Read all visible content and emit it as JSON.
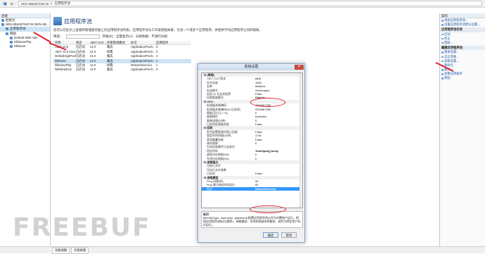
{
  "address": {
    "host": "WIN-3B54E7N87J9",
    "page": "应用程序池"
  },
  "left": {
    "header": "连接",
    "tree": [
      {
        "label": "起始页",
        "depth": 0
      },
      {
        "label": "WIN-3B54E7N87J9 (WIN-3B...",
        "depth": 0
      },
      {
        "label": "应用程序池",
        "depth": 1,
        "selected": true
      },
      {
        "label": "网站",
        "depth": 1
      },
      {
        "label": "Default Web Site",
        "depth": 2
      },
      {
        "label": "hillstonePhp",
        "depth": 2
      },
      {
        "label": "hillstone",
        "depth": 2
      }
    ]
  },
  "main": {
    "title": "应用程序池",
    "description": "您可以在此页上查看和管理服务器上的应用程序池列表。应用程序池与工作进程相关联，包含一个或多个应用程序，并提供不同应用程序之间的隔离。",
    "filter": {
      "label": "筛选：",
      "go": "开始(G)",
      "show_all": "全部显示(A)",
      "group_by": "分组依据：不进行分组"
    },
    "columns": [
      "名称",
      "状态",
      ".NET CLR...",
      "托管管道模式",
      "标识",
      "应用程序"
    ],
    "rows": [
      [
        ".NET v4.5",
        "已启动",
        "v4.0",
        "集成",
        "ApplicationPoolI...",
        "0"
      ],
      [
        ".NET v4.5 Clas...",
        "已启动",
        "v4.0",
        "经典",
        "ApplicationPoolI...",
        "0"
      ],
      [
        "DefaultAppPool",
        "已启动",
        "v4.0",
        "集成",
        "ApplicationPoolI...",
        "4"
      ],
      [
        "hillstone",
        "已启动",
        "v4.0",
        "集成",
        "ApplicationPoolI...",
        "1"
      ],
      [
        "hillstonePhp",
        "已启动",
        "v4.0",
        "经典",
        "NetworkService",
        "1"
      ],
      [
        "NDWebdocs",
        "已启动",
        "v4.0",
        "集成",
        "ApplicationPoolI...",
        "0"
      ]
    ],
    "selected_row": 3
  },
  "dialog": {
    "title": "高级设置",
    "props": [
      {
        "cat": true,
        "name": "(常规)"
      },
      {
        "name": ".NET CLR 版本",
        "value": "v4.0",
        "bold": true
      },
      {
        "name": "队列长度",
        "value": "1000"
      },
      {
        "name": "名称",
        "value": "hillstone"
      },
      {
        "name": "启动模式",
        "value": "OnDemand"
      },
      {
        "name": "启用 32 位应用程序",
        "value": "False"
      },
      {
        "name": "托管管道模式",
        "value": "Classic",
        "bold": true
      },
      {
        "cat": true,
        "name": "CPU"
      },
      {
        "name": "处理器关联掩码",
        "value": "4294967295"
      },
      {
        "name": "处理器关联掩码(64 位选项)",
        "value": "4294967295"
      },
      {
        "name": "限制(百分之一%)",
        "value": "0"
      },
      {
        "name": "限制操作",
        "value": "NoAction"
      },
      {
        "name": "限制间隔(分钟)",
        "value": "5"
      },
      {
        "name": "已启用处理器关联",
        "value": "False"
      },
      {
        "cat": true,
        "name": "回收"
      },
      {
        "name": "发生配置更改时禁止回收",
        "value": "False"
      },
      {
        "name": "固定时间间隔(分钟)",
        "value": "1740"
      },
      {
        "name": "禁用重叠回收",
        "value": "False"
      },
      {
        "name": "请求限制",
        "value": "0"
      },
      {
        "name": "生成回收事件日志条目",
        "value": ""
      },
      {
        "name": "特定时间",
        "value": "TimeSpan[] Array",
        "bold": true
      },
      {
        "name": "虚拟内存限制(KB)",
        "value": "0"
      },
      {
        "name": "专用内存限制(KB)",
        "value": "0"
      },
      {
        "cat": true,
        "name": "进程孤立"
      },
      {
        "name": "可执行文件",
        "value": ""
      },
      {
        "name": "可执行文件参数",
        "value": ""
      },
      {
        "name": "已启用",
        "value": "False"
      },
      {
        "cat": true,
        "name": "进程模型"
      },
      {
        "name": "Ping 间隔(秒)",
        "value": "30"
      },
      {
        "name": "Ping 最大响应时间(秒)",
        "value": "90"
      },
      {
        "name": "标识",
        "value": "NetworkService",
        "bold": true,
        "selected": true
      }
    ],
    "desc_title": "标识",
    "desc_text": "[identityType, username, password] 配置应用程序池以作为内置帐户运行，例如应用程序池标识(推荐)、网络服务、本地系统或本地服务，或作为特定用户标识运行。",
    "ok": "确定",
    "cancel": "取消"
  },
  "actions": {
    "header": "操作",
    "sections": [
      {
        "items": [
          "添加应用程序池...",
          "设置应用程序池默认设置..."
        ]
      },
      {
        "title": "应用程序池任务",
        "items": [
          "启动",
          "停止",
          "回收..."
        ]
      },
      {
        "title": "编辑应用程序池",
        "items": [
          "基本设置...",
          "正在回收...",
          "高级设置...",
          "重命名"
        ]
      },
      {
        "items": [
          "删除",
          "查看应用程序"
        ]
      },
      {
        "items": [
          "帮助"
        ]
      }
    ]
  },
  "status": {
    "tabs": [
      "功能视图",
      "内容视图"
    ]
  },
  "watermark": "FREEBUF"
}
